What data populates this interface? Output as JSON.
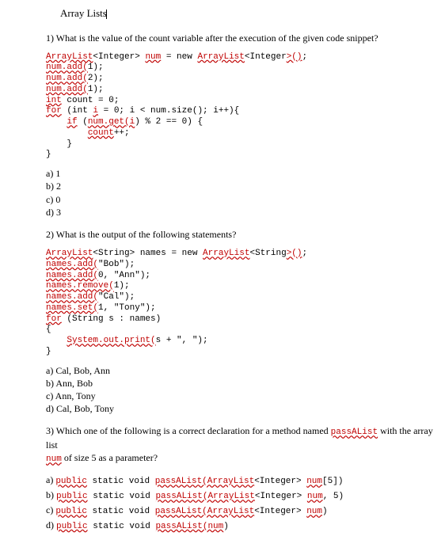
{
  "title": "Array Lists",
  "q1": {
    "prompt": "1) What is the value of the count variable after the execution of the given code snippet?",
    "answers": {
      "a": "a) 1",
      "b": "b) 2",
      "c": "c) 0",
      "d": "d) 3"
    }
  },
  "q2": {
    "prompt": "2) What is the output of the following statements?",
    "answers": {
      "a": "a) Cal, Bob, Ann",
      "b": "b) Ann, Bob",
      "c": "c) Ann, Tony",
      "d": "d) Cal, Bob, Tony"
    }
  },
  "q3": {
    "prompt_part1": "3) Which one of the following is a correct declaration for a method named ",
    "prompt_code1": "passAList",
    "prompt_part2": " with the array list ",
    "prompt_code2": "num",
    "prompt_part3": " of size 5 as a parameter?"
  },
  "chart_data": {
    "type": "table",
    "title": "Multiple-choice quiz on Java ArrayList",
    "questions": [
      {
        "number": 1,
        "prompt": "What is the value of the count variable after the execution of the given code snippet?",
        "code": "ArrayList<Integer> num = new ArrayList<Integer>();\nnum.add(1);\nnum.add(2);\nnum.add(1);\nint count = 0;\nfor (int i = 0; i < num.size(); i++){\n    if (num.get(i) % 2 == 0) {\n        count++;\n    }\n}",
        "options": {
          "a": "1",
          "b": "2",
          "c": "0",
          "d": "3"
        }
      },
      {
        "number": 2,
        "prompt": "What is the output of the following statements?",
        "code": "ArrayList<String> names = new ArrayList<String>();\nnames.add(\"Bob\");\nnames.add(0, \"Ann\");\nnames.remove(1);\nnames.add(\"Cal\");\nnames.set(1, \"Tony\");\nfor (String s : names)\n{\n    System.out.print(s + \", \");\n}",
        "options": {
          "a": "Cal, Bob, Ann",
          "b": "Ann, Bob",
          "c": "Ann, Tony",
          "d": "Cal, Bob, Tony"
        }
      },
      {
        "number": 3,
        "prompt": "Which one of the following is a correct declaration for a method named passAList with the array list num of size 5 as a parameter?",
        "options": {
          "a": "public static void passAList(ArrayList<Integer> num[5])",
          "b": "public static void passAList(ArrayList<Integer> num, 5)",
          "c": "public static void passAList(ArrayList<Integer> num)",
          "d": "public static void passAList(num)"
        }
      }
    ]
  }
}
